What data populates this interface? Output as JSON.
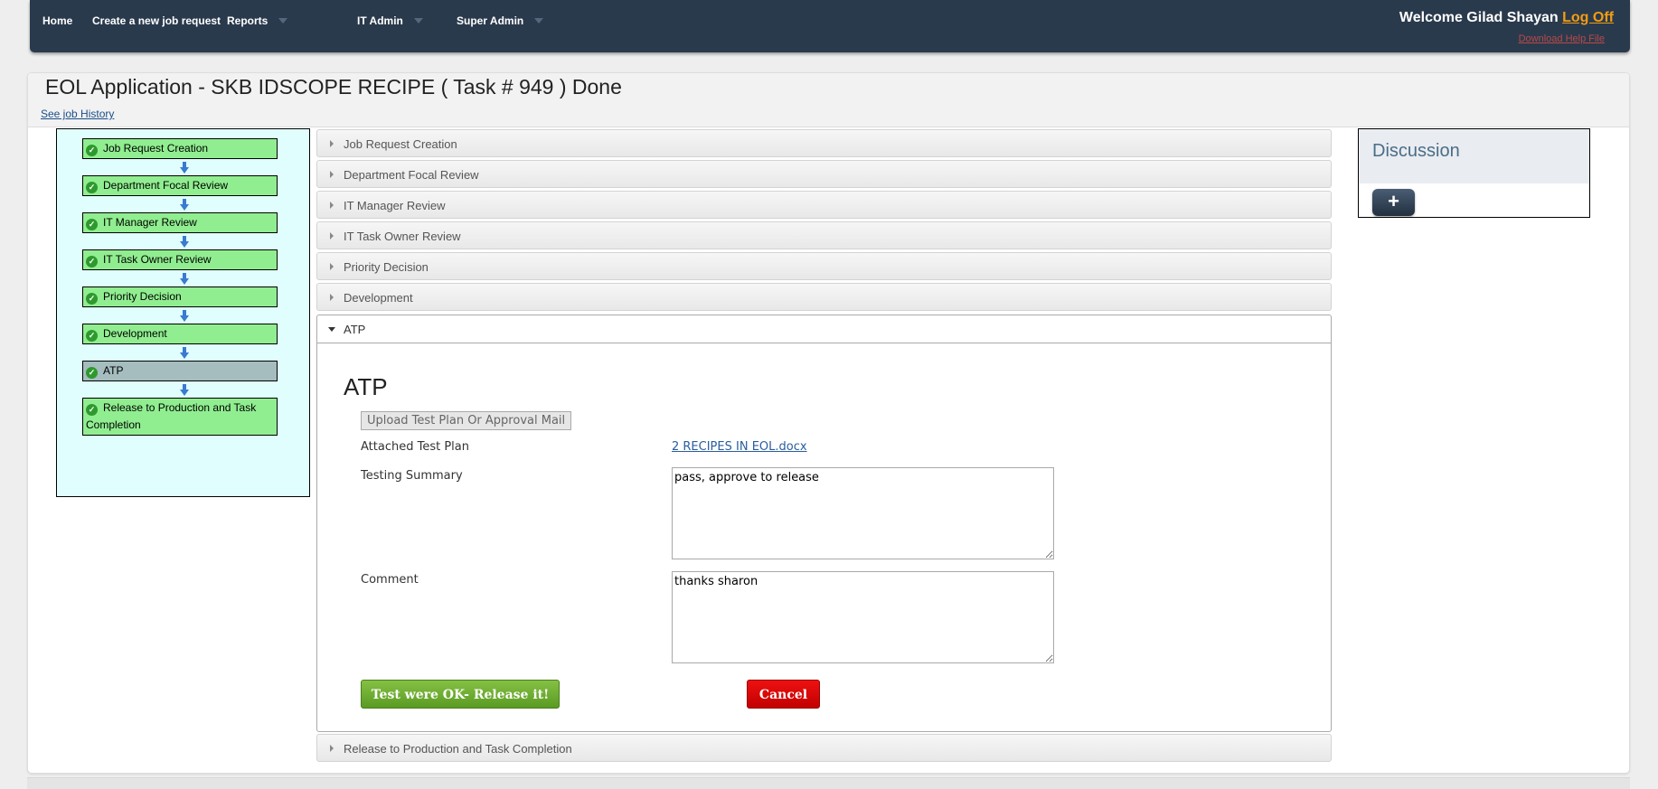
{
  "nav": {
    "items": [
      {
        "label": "Home",
        "has_caret": false
      },
      {
        "label": "Create a new job request",
        "has_caret": false
      },
      {
        "label": "Reports",
        "has_caret": true
      },
      {
        "label": "IT Admin",
        "has_caret": true
      },
      {
        "label": "Super Admin",
        "has_caret": true
      }
    ],
    "welcome_text": "Welcome Gilad Shayan",
    "logoff_label": "Log Off",
    "help_link": "Download Help File"
  },
  "page": {
    "title": "EOL Application - SKB IDSCOPE RECIPE ( Task # 949 ) Done",
    "history_link": "See job History"
  },
  "workflow": {
    "steps": [
      {
        "label": "Job Request Creation",
        "active": false
      },
      {
        "label": "Department Focal Review",
        "active": false
      },
      {
        "label": "IT Manager Review",
        "active": false
      },
      {
        "label": "IT Task Owner Review",
        "active": false
      },
      {
        "label": "Priority Decision",
        "active": false
      },
      {
        "label": "Development",
        "active": false
      },
      {
        "label": "ATP",
        "active": true
      },
      {
        "label": "Release to Production and Task Completion",
        "active": false
      }
    ]
  },
  "accordion": {
    "collapsed_above": [
      "Job Request Creation",
      "Department Focal Review",
      "IT Manager Review",
      "IT Task Owner Review",
      "Priority Decision",
      "Development"
    ],
    "open_section": "ATP",
    "collapsed_below": [
      "Release to Production and Task Completion"
    ]
  },
  "atp": {
    "heading": "ATP",
    "upload_button": "Upload Test Plan Or Approval Mail",
    "attached_label": "Attached Test Plan",
    "attached_file": "2 RECIPES IN EOL.docx",
    "summary_label": "Testing Summary",
    "summary_value": "pass, approve to release",
    "comment_label": "Comment",
    "comment_value": "thanks sharon",
    "ok_button": "Test were OK- Release it!",
    "cancel_button": "Cancel"
  },
  "discussion": {
    "title": "Discussion",
    "add_button": "+"
  },
  "colors": {
    "navbar": "#2a3a4d",
    "step_done": "#90ee90",
    "step_active": "#a5bdbf",
    "workflow_bg": "#e1fefe",
    "logoff": "#f39c12",
    "ok_button": "#6aac2e",
    "cancel_button": "#dd0000"
  },
  "icons": {
    "step_status": "check-circle-icon",
    "step_connector": "arrow-down-icon",
    "accordion_collapsed": "triangle-right-icon",
    "accordion_expanded": "triangle-down-icon"
  }
}
